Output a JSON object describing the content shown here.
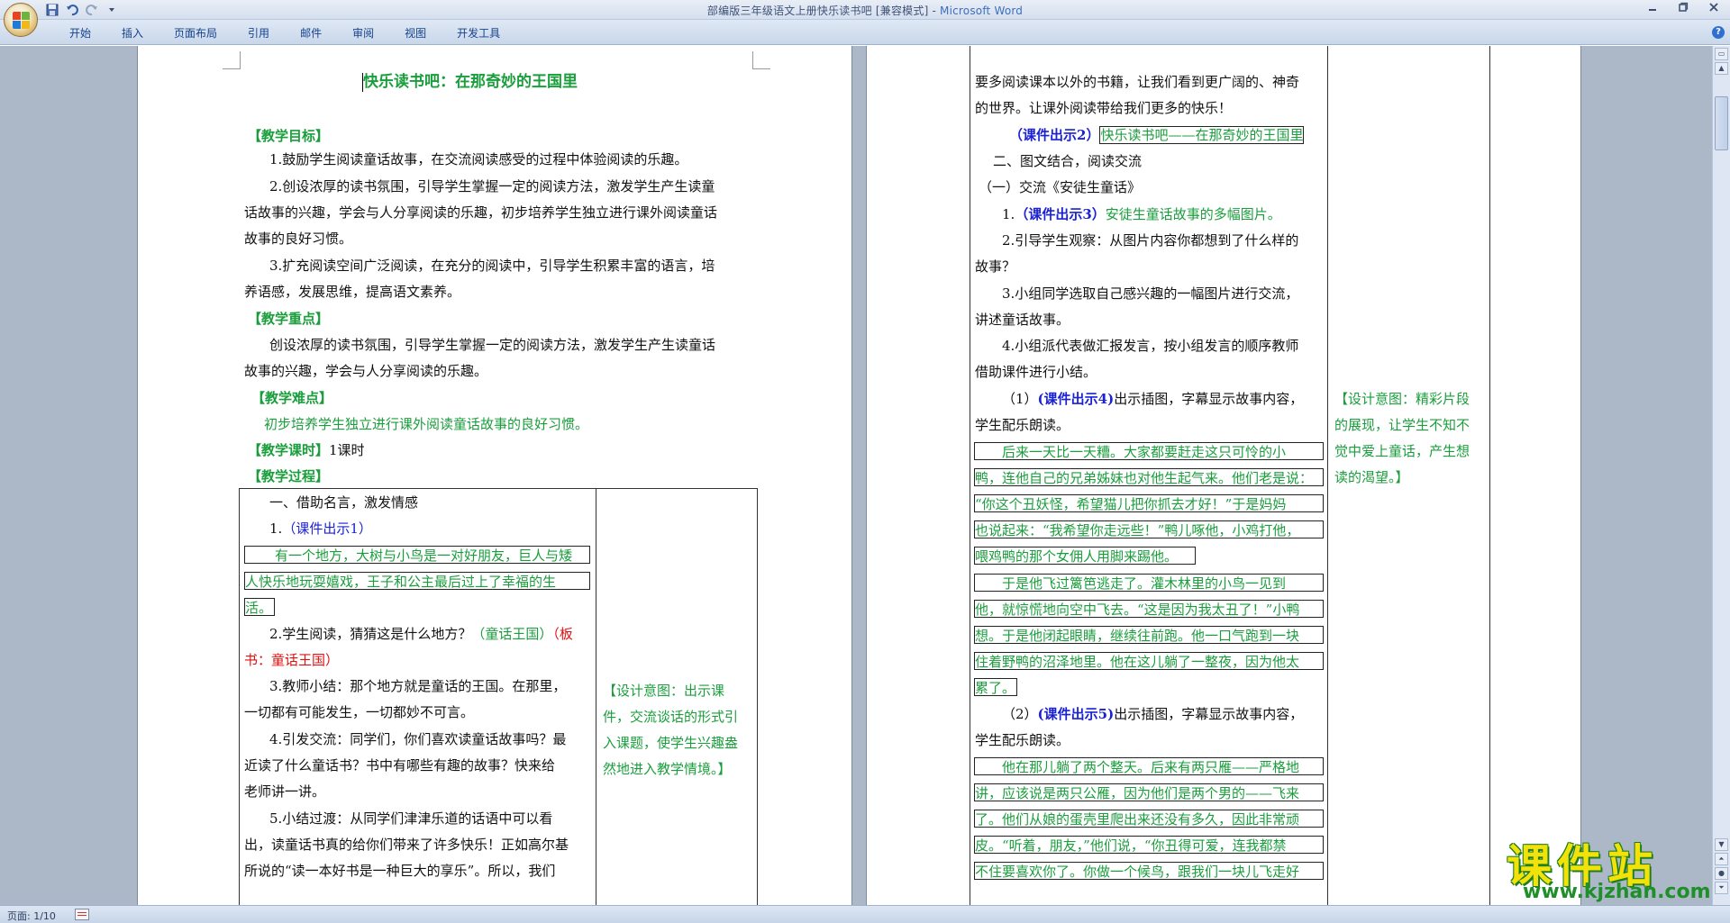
{
  "window": {
    "title_doc": "部编版三年级语文上册快乐读书吧 [兼容模式]",
    "title_sep": " - ",
    "title_app": "Microsoft Word"
  },
  "quick_access": {
    "icons": [
      "save-icon",
      "undo-icon",
      "redo-icon",
      "customize-icon"
    ]
  },
  "ribbon": {
    "tabs": [
      "开始",
      "插入",
      "页面布局",
      "引用",
      "邮件",
      "审阅",
      "视图",
      "开发工具"
    ]
  },
  "statusbar": {
    "page": "页面: 1/10"
  },
  "page1": {
    "title": "快乐读书吧：在那奇妙的王国里",
    "goal_head": "【教学目标】",
    "goal1": "1.鼓励学生阅读童话故事，在交流阅读感受的过程中体验阅读的乐趣。",
    "goal2a": "2.创设浓厚的读书氛围，引导学生掌握一定的阅读方法，激发学生产生读童",
    "goal2b": "话故事的兴趣，学会与人分享阅读的乐趣，初步培养学生独立进行课外阅读童话",
    "goal2c": "故事的良好习惯。",
    "goal3a": "3.扩充阅读空间广泛阅读，在充分的阅读中，引导学生积累丰富的语言，培",
    "goal3b": "养语感，发展思维，提高语文素养。",
    "key_head": "【教学重点】",
    "key_a": "创设浓厚的读书氛围，引导学生掌握一定的阅读方法，激发学生产生读童话",
    "key_b": "故事的兴趣，学会与人分享阅读的乐趣。",
    "diff_head": "【教学难点】",
    "diff": "初步培养学生独立进行课外阅读童话故事的良好习惯。",
    "hours_head": "【教学课时】",
    "hours": "1课时",
    "process_head": "【教学过程】",
    "t_1": "一、借助名言，激发情感",
    "t_2_num": "1.",
    "t_2_blue": "（课件出示1）",
    "t_3": "有一个地方，大树与小鸟是一对好朋友，巨人与矮",
    "t_4": "人快乐地玩耍嬉戏，王子和公主最后过上了幸福的生",
    "t_5": "活。",
    "t_6a": "2.学生阅读，猜猜这是什么地方？",
    "t_6b": "（童话王国）",
    "t_6c": "（板",
    "t_7": "书：童话王国）",
    "t_8": "3.教师小结：那个地方就是童话的王国。在那里，",
    "t_9": "一切都有可能发生，一切都妙不可言。",
    "t_10": "4.引发交流：同学们，你们喜欢读童话故事吗？最",
    "t_11": "近读了什么童话书？书中有哪些有趣的故事？快来给",
    "t_12": "老师讲一讲。",
    "t_13": "5.小结过渡：从同学们津津乐道的话语中可以看",
    "t_14": "出，读童话书真的给你们带来了许多快乐！正如高尔基",
    "t_15": "所说的“读一本好书是一种巨大的享乐”。所以，我们",
    "side_1": "【设计意图：出示课",
    "side_2": "件，交流谈话的形式引",
    "side_3": "入课题，使学生兴趣盎",
    "side_4": "然地进入教学情境。】"
  },
  "page2": {
    "r1": "要多阅读课本以外的书籍，让我们看到更广阔的、神奇",
    "r2": "的世界。让课外阅读带给我们更多的快乐！",
    "r3_blue": "（课件出示2）",
    "r3_green": "快乐读书吧——在那奇妙的王国里",
    "r4": "二、图文结合，阅读交流",
    "r5": "（一）交流《安徒生童话》",
    "r6_num": "1.",
    "r6_blue": "（课件出示3）",
    "r6_green": "安徒生童话故事的多幅图片。",
    "r7": "2.引导学生观察：从图片内容你都想到了什么样的",
    "r8": "故事？",
    "r9": "3.小组同学选取自己感兴趣的一幅图片进行交流，",
    "r10": "讲述童话故事。",
    "r11": "4.小组派代表做汇报发言，按小组发言的顺序教师",
    "r12": "借助课件进行小结。",
    "r13_num": "（1）",
    "r13_blue": "(课件出示4)",
    "r13_rest": "出示插图，字幕显示故事内容，",
    "r14": "学生配乐朗读。",
    "r15": "后来一天比一天糟。大家都要赶走这只可怜的小",
    "r16": "鸭，连他自己的兄弟姊妹也对他生起气来。他们老是说：",
    "r17": "“你这个丑妖怪，希望猫儿把你抓去才好！”于是妈妈",
    "r18": "也说起来：“我希望你走远些！”鸭儿啄他，小鸡打他，",
    "r19": "喂鸡鸭的那个女佣人用脚来踢他。",
    "r20": "于是他飞过篱笆逃走了。灌木林里的小鸟一见到",
    "r21": "他，就惊慌地向空中飞去。“这是因为我太丑了！”小鸭",
    "r22": "想。于是他闭起眼睛，继续往前跑。他一口气跑到一块",
    "r23": "住着野鸭的沼泽地里。他在这儿躺了一整夜，因为他太",
    "r24": "累了。",
    "r25_num": "（2）",
    "r25_blue": "(课件出示5)",
    "r25_rest": "出示插图，字幕显示故事内容，",
    "r26": "学生配乐朗读。",
    "r27": "他在那儿躺了两个整天。后来有两只雁——严格地",
    "r28": "讲，应该说是两只公雁，因为他们是两个男的——飞来",
    "r29": "了。他们从娘的蛋壳里爬出来还没有多久，因此非常顽",
    "r30": "皮。“听着，朋友，”他们说，“你丑得可爱，连我都禁",
    "r31": "不住要喜欢你了。你做一个候鸟，跟我们一块儿飞走好",
    "side_1": "【设计意图：精彩片段",
    "side_2": "的展现，让学生不知不",
    "side_3": "觉中爱上童话，产生想",
    "side_4": "读的渴望。】"
  },
  "watermark": {
    "big": "课件站",
    "url": "www.kjzhan.com"
  },
  "colors": {
    "green_text": "#1a9e3c",
    "blue_text": "#1a22d4",
    "red_text": "#e01010",
    "ribbon_tab_text": "#15428b",
    "workspace": "#acb7c7"
  }
}
